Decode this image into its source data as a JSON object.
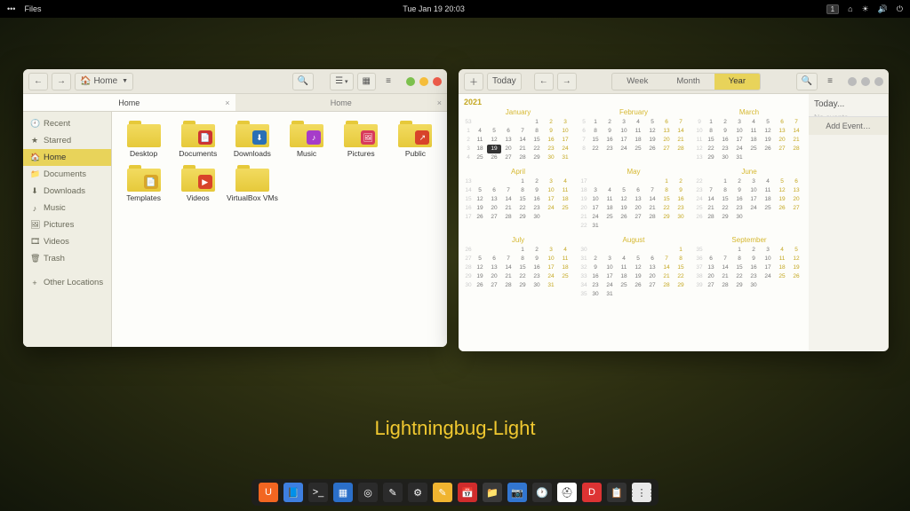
{
  "topbar": {
    "left_app": "Files",
    "datetime": "Tue Jan 19  20:03",
    "workspace": "1"
  },
  "theme_name": "Lightningbug-Light",
  "files": {
    "path_label": "Home",
    "tabs": [
      "Home",
      "Home"
    ],
    "active_tab": 0,
    "sidebar": [
      {
        "icon": "🕘",
        "label": "Recent"
      },
      {
        "icon": "★",
        "label": "Starred"
      },
      {
        "icon": "🏠",
        "label": "Home",
        "active": true
      },
      {
        "icon": "📁",
        "label": "Documents"
      },
      {
        "icon": "⬇",
        "label": "Downloads"
      },
      {
        "icon": "♪",
        "label": "Music"
      },
      {
        "icon": "🖼",
        "label": "Pictures"
      },
      {
        "icon": "🎞",
        "label": "Videos"
      },
      {
        "icon": "🗑",
        "label": "Trash"
      }
    ],
    "other_locations": "Other Locations",
    "folders": [
      {
        "name": "Desktop",
        "badge": null
      },
      {
        "name": "Documents",
        "badge": "#c33",
        "glyph": "📄"
      },
      {
        "name": "Downloads",
        "badge": "#2a6fb5",
        "glyph": "⬇"
      },
      {
        "name": "Music",
        "badge": "#a63cc9",
        "glyph": "♪"
      },
      {
        "name": "Pictures",
        "badge": "#d83a5a",
        "glyph": "🖼"
      },
      {
        "name": "Public",
        "badge": "#d8432a",
        "glyph": "↗"
      },
      {
        "name": "Templates",
        "badge": "#d8a62a",
        "glyph": "📄"
      },
      {
        "name": "Videos",
        "badge": "#d8432a",
        "glyph": "▶"
      },
      {
        "name": "VirtualBox VMs",
        "badge": null
      }
    ]
  },
  "calendar": {
    "today_btn": "Today",
    "views": {
      "week": "Week",
      "month": "Month",
      "year": "Year",
      "active": "year"
    },
    "side_title": "Today...",
    "side_empty": "No events",
    "add_event": "Add Event…",
    "year": "2021",
    "today": {
      "month": "January",
      "day": 19
    },
    "months": [
      "January",
      "February",
      "March",
      "April",
      "May",
      "June",
      "July",
      "August",
      "September"
    ],
    "first_week_num": [
      53,
      5,
      9,
      13,
      17,
      22,
      26,
      30,
      35
    ],
    "days_in_month": [
      31,
      28,
      31,
      30,
      31,
      30,
      31,
      31,
      30
    ],
    "start_weekday": [
      4,
      0,
      0,
      3,
      5,
      1,
      3,
      6,
      2
    ]
  },
  "dock": [
    {
      "bg": "#f26621",
      "g": "U"
    },
    {
      "bg": "#3e7fe0",
      "g": "📘"
    },
    {
      "bg": "#2b2b2b",
      "g": ">_"
    },
    {
      "bg": "#2b6fc9",
      "g": "▦"
    },
    {
      "bg": "#2b2b2b",
      "g": "◎"
    },
    {
      "bg": "#2b2b2b",
      "g": "✎"
    },
    {
      "bg": "#2b2b2b",
      "g": "⚙"
    },
    {
      "bg": "#f0b430",
      "g": "✎"
    },
    {
      "bg": "#d02c2c",
      "g": "📅"
    },
    {
      "bg": "#3a3a3a",
      "g": "📁"
    },
    {
      "bg": "#3276d0",
      "g": "📷"
    },
    {
      "bg": "#303030",
      "g": "🕐"
    },
    {
      "bg": "#ffffff",
      "g": "⛑"
    },
    {
      "bg": "#d33",
      "g": "D"
    },
    {
      "bg": "#333",
      "g": "📋"
    },
    {
      "bg": "#e8e8e8",
      "g": "⋮⋮⋮"
    }
  ]
}
